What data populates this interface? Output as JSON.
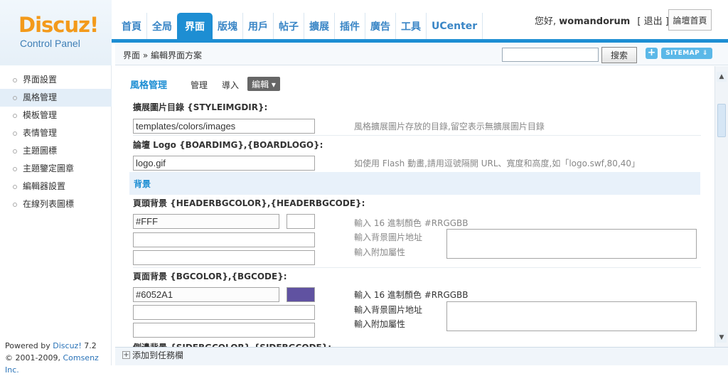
{
  "logo": {
    "brand": "Discuz!",
    "subtitle": "Control Panel"
  },
  "nav": {
    "tabs": [
      "首頁",
      "全局",
      "界面",
      "版塊",
      "用戶",
      "帖子",
      "擴展",
      "插件",
      "廣告",
      "工具",
      "UCenter"
    ],
    "active_tab": "界面"
  },
  "user": {
    "greeting": "您好,",
    "name": "womandorum",
    "logout": "[ 退出 ]",
    "forum_home": "論壇首頁"
  },
  "subbar": {
    "breadcrumb": "界面 » 編輯界面方案",
    "search_button": "搜索",
    "plus": "+",
    "sitemap": "SITEMAP ⇓",
    "search_value": ""
  },
  "sidebar": {
    "items": [
      "界面設置",
      "風格管理",
      "模板管理",
      "表情管理",
      "主題圖標",
      "主題鑒定圖章",
      "編輯器設置",
      "在線列表圖標"
    ],
    "active_index": 1,
    "powered_prefix": "Powered by ",
    "powered_name": "Discuz!",
    "powered_version": " 7.2",
    "copyright_prefix": "© 2001-2009, ",
    "copyright_name": "Comsenz Inc."
  },
  "content": {
    "title": "風格管理",
    "ops": {
      "manage": "管理",
      "import": "導入",
      "edit": "編輯 ▾"
    },
    "fields": {
      "styleimgdir": {
        "label": "擴展圖片目錄 {STYLEIMGDIR}:",
        "value": "templates/colors/images",
        "hint": "風格擴展圖片存放的目錄,留空表示無擴展圖片目錄"
      },
      "boardimg": {
        "label": "論壇 Logo {BOARDIMG},{BOARDLOGO}:",
        "value": "logo.gif",
        "hint": "如使用 Flash 動畫,請用逗號隔開 URL、寬度和高度,如「logo.swf,80,40」"
      }
    },
    "section_background": "背景",
    "headerbg": {
      "label": "頁頭背景 {HEADERBGCOLOR},{HEADERBGCODE}:",
      "color_value": "#FFF",
      "swatch_color": "#FFFFFF",
      "hint_color": "輸入 16 進制顏色 #RRGGBB",
      "hint_image": "輸入背景圖片地址",
      "hint_attr": "輸入附加屬性"
    },
    "pagebg": {
      "label": "頁面背景 {BGCOLOR},{BGCODE}:",
      "color_value": "#6052A1",
      "swatch_color": "#6052A1",
      "hint_color": "輸入 16 進制顏色 #RRGGBB",
      "hint_image": "輸入背景圖片地址",
      "hint_attr": "輸入附加屬性"
    },
    "sidebg_partial": "側邊背景 {SIDEBGCOLOR},{SIDEBGCODE}:"
  },
  "taskbar": {
    "add_label": "添加到任務欄",
    "add_icon": "+"
  }
}
